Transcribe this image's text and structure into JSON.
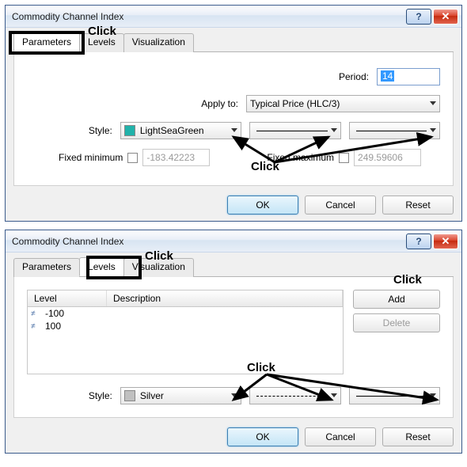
{
  "dialog1": {
    "title": "Commodity Channel Index",
    "tabs": {
      "parameters": "Parameters",
      "levels": "Levels",
      "visualization": "Visualization"
    },
    "period_label": "Period:",
    "period_value": "14",
    "applyto_label": "Apply to:",
    "applyto_value": "Typical Price (HLC/3)",
    "style_label": "Style:",
    "style_color_name": "LightSeaGreen",
    "style_color_hex": "#20b2aa",
    "fixedmin_label": "Fixed minimum",
    "fixedmin_value": "-183.42223",
    "fixedmax_label": "Fixed maximum",
    "fixedmax_value": "249.59606",
    "buttons": {
      "ok": "OK",
      "cancel": "Cancel",
      "reset": "Reset"
    },
    "annotations": {
      "click_tab": "Click",
      "click_style": "Click"
    }
  },
  "dialog2": {
    "title": "Commodity Channel Index",
    "tabs": {
      "parameters": "Parameters",
      "levels": "Levels",
      "visualization": "Visualization"
    },
    "table_headers": {
      "level": "Level",
      "description": "Description"
    },
    "levels": [
      {
        "value": "-100",
        "description": ""
      },
      {
        "value": "100",
        "description": ""
      }
    ],
    "add_label": "Add",
    "delete_label": "Delete",
    "style_label": "Style:",
    "style_color_name": "Silver",
    "style_color_hex": "#c0c0c0",
    "buttons": {
      "ok": "OK",
      "cancel": "Cancel",
      "reset": "Reset"
    },
    "annotations": {
      "click_tab": "Click",
      "click_add": "Click",
      "click_style": "Click"
    }
  }
}
